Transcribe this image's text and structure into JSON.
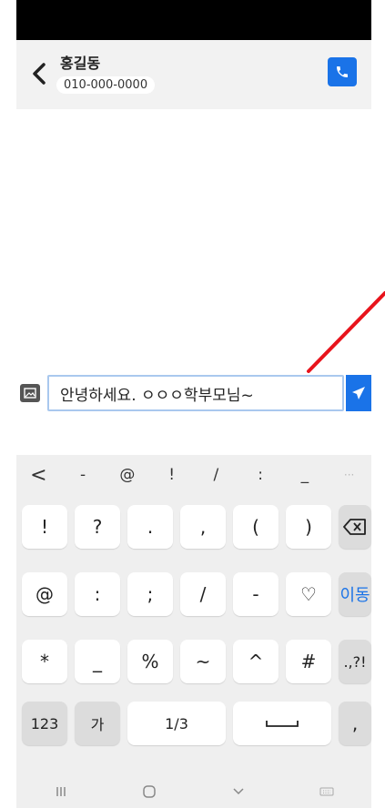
{
  "header": {
    "contact_name": "홍길동",
    "phone_number": "010-000-0000"
  },
  "composer": {
    "message_value": "안녕하세요. ㅇㅇㅇ학부모님~"
  },
  "keyboard": {
    "symbol_row": [
      "<",
      "-",
      "@",
      "!",
      "/",
      ":",
      "_",
      "···"
    ],
    "rows": [
      [
        "!",
        "?",
        ".",
        ",",
        "(",
        ")"
      ],
      [
        "@",
        ":",
        ";",
        "/",
        "-",
        "♡"
      ],
      [
        "*",
        "_",
        "%",
        "~",
        "^",
        "#"
      ]
    ],
    "enter_label": "이동",
    "punct_label": ".,?!",
    "numbers_label": "123",
    "korean_label": "가",
    "page_label": "1/3",
    "comma_label": ","
  },
  "colors": {
    "accent": "#1a73e8",
    "annotation_line": "#e8141c"
  }
}
